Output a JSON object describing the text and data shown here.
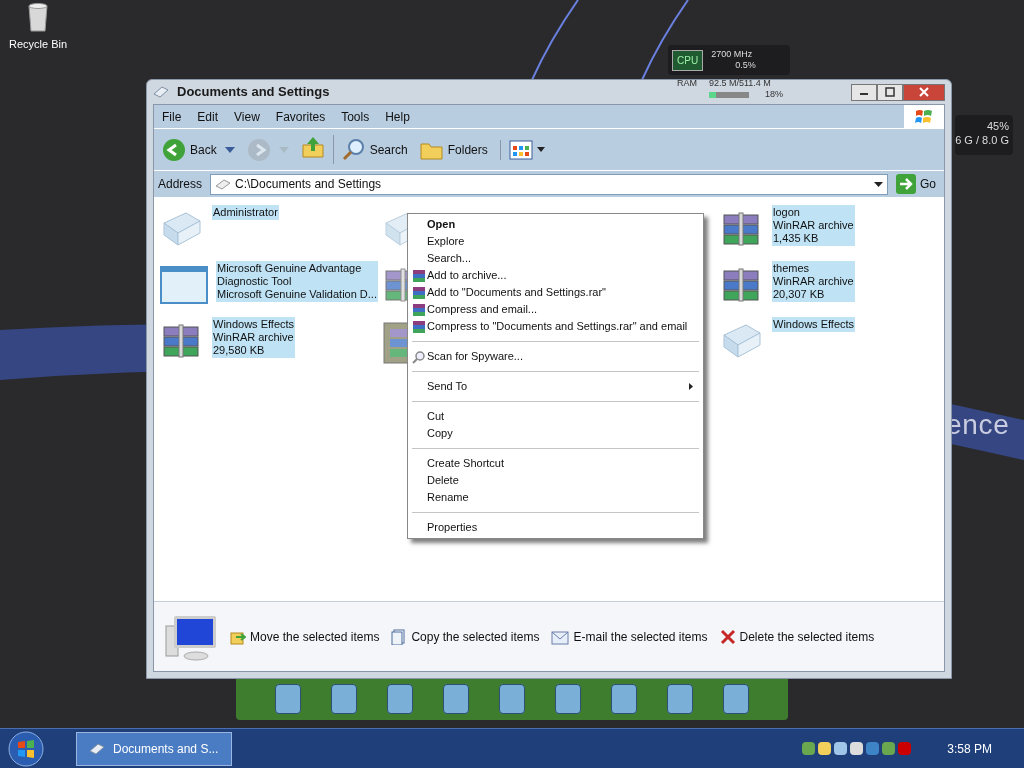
{
  "desktop": {
    "icons": [
      {
        "label": "Recycle Bin"
      }
    ],
    "wallpaper_text": "ence",
    "cpu_widget": {
      "badge": "CPU",
      "clock": "2700 MHz",
      "usage": "0.5%"
    },
    "ram_widget": {
      "label": "RAM",
      "amount": "92.5 M/511.4 M",
      "usage": "18%",
      "level": 0.18
    },
    "disk_widget": {
      "usage": "45%",
      "amount": "6 G / 8.0 G"
    }
  },
  "window": {
    "title": "Documents and Settings",
    "menu": [
      "File",
      "Edit",
      "View",
      "Favorites",
      "Tools",
      "Help"
    ],
    "toolbar": [
      {
        "kind": "back",
        "label": "Back",
        "disabled": false
      },
      {
        "kind": "forward",
        "disabled": true
      },
      {
        "kind": "up"
      },
      {
        "kind": "search",
        "label": "Search"
      },
      {
        "kind": "folders",
        "label": "Folders"
      },
      {
        "kind": "views"
      }
    ],
    "address": {
      "label": "Address",
      "value": "C:\\Documents and Settings",
      "go": "Go"
    },
    "files": [
      {
        "kind": "folder",
        "lines": [
          "Administrator"
        ],
        "selected": true
      },
      {
        "kind": "folder"
      },
      {
        "kind": "archive",
        "lines": [
          "logon",
          "WinRAR archive",
          "1,435 KB"
        ],
        "selected": true
      },
      {
        "kind": "window",
        "lines": [
          "Microsoft Genuine Advantage",
          "Diagnostic Tool",
          "Microsoft Genuine Validation D..."
        ],
        "selected": true
      },
      {
        "kind": "archive"
      },
      {
        "kind": "archive",
        "lines": [
          "themes",
          "WinRAR archive",
          "20,307 KB"
        ],
        "selected": true
      },
      {
        "kind": "archive",
        "lines": [
          "Windows Effects",
          "WinRAR archive",
          "29,580 KB"
        ],
        "selected": true
      },
      {
        "kind": "installer"
      },
      {
        "kind": "folder",
        "lines": [
          "Windows Effects"
        ],
        "selected": true
      }
    ],
    "tasks": [
      {
        "kind": "move",
        "label": "Move the selected items"
      },
      {
        "kind": "copy",
        "label": "Copy the selected items"
      },
      {
        "kind": "email",
        "label": "E-mail the selected items"
      },
      {
        "kind": "delete",
        "label": "Delete the selected items"
      }
    ]
  },
  "context_menu": [
    {
      "kind": "item",
      "label": "Open",
      "default": true
    },
    {
      "kind": "item",
      "label": "Explore"
    },
    {
      "kind": "item",
      "label": "Search..."
    },
    {
      "kind": "archive",
      "label": "Add to archive..."
    },
    {
      "kind": "archive",
      "label": "Add to \"Documents and Settings.rar\""
    },
    {
      "kind": "archive",
      "label": "Compress and email..."
    },
    {
      "kind": "archive",
      "label": "Compress to \"Documents and Settings.rar\" and email"
    },
    {
      "kind": "separator"
    },
    {
      "kind": "scan",
      "label": "Scan for Spyware..."
    },
    {
      "kind": "separator"
    },
    {
      "kind": "item",
      "label": "Send To",
      "submenu": true
    },
    {
      "kind": "separator"
    },
    {
      "kind": "item",
      "label": "Cut"
    },
    {
      "kind": "item",
      "label": "Copy"
    },
    {
      "kind": "separator"
    },
    {
      "kind": "item",
      "label": "Create Shortcut"
    },
    {
      "kind": "item",
      "label": "Delete"
    },
    {
      "kind": "item",
      "label": "Rename"
    },
    {
      "kind": "separator"
    },
    {
      "kind": "item",
      "label": "Properties"
    }
  ],
  "taskbar": {
    "tasks": [
      {
        "label": "Documents and S...",
        "selected": true
      }
    ],
    "clock": "3:58 PM"
  }
}
